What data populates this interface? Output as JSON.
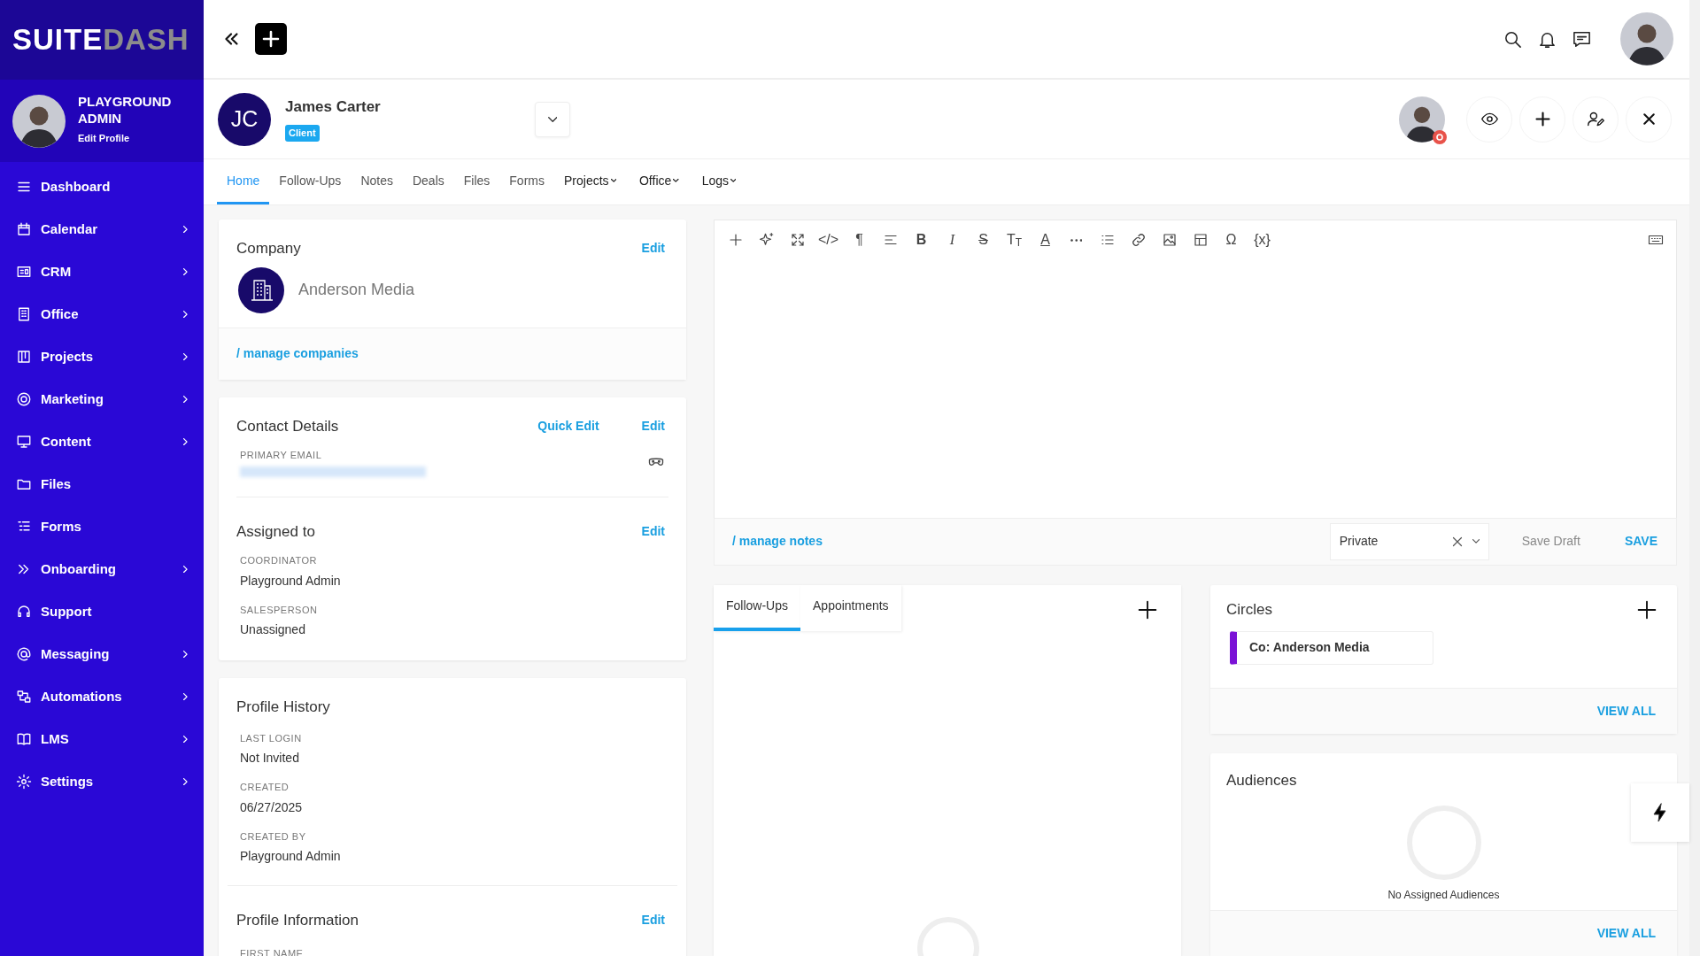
{
  "logo": {
    "first": "SUITE",
    "second": "DASH"
  },
  "profile": {
    "name": "PLAYGROUND ADMIN",
    "link": "Edit Profile"
  },
  "nav": [
    {
      "label": "Dashboard",
      "expandable": false
    },
    {
      "label": "Calendar",
      "expandable": true
    },
    {
      "label": "CRM",
      "expandable": true
    },
    {
      "label": "Office",
      "expandable": true
    },
    {
      "label": "Projects",
      "expandable": true
    },
    {
      "label": "Marketing",
      "expandable": true
    },
    {
      "label": "Content",
      "expandable": true
    },
    {
      "label": "Files",
      "expandable": false
    },
    {
      "label": "Forms",
      "expandable": false
    },
    {
      "label": "Onboarding",
      "expandable": true
    },
    {
      "label": "Support",
      "expandable": false
    },
    {
      "label": "Messaging",
      "expandable": true
    },
    {
      "label": "Automations",
      "expandable": true
    },
    {
      "label": "LMS",
      "expandable": true
    },
    {
      "label": "Settings",
      "expandable": true
    }
  ],
  "contact": {
    "initials": "JC",
    "name": "James Carter",
    "badge": "Client"
  },
  "tabs": [
    {
      "label": "Home",
      "selected": true,
      "dropdown": false
    },
    {
      "label": "Follow-Ups",
      "selected": false,
      "dropdown": false
    },
    {
      "label": "Notes",
      "selected": false,
      "dropdown": false
    },
    {
      "label": "Deals",
      "selected": false,
      "dropdown": false
    },
    {
      "label": "Files",
      "selected": false,
      "dropdown": false
    },
    {
      "label": "Forms",
      "selected": false,
      "dropdown": false
    },
    {
      "label": "Projects",
      "selected": false,
      "dropdown": true
    },
    {
      "label": "Office",
      "selected": false,
      "dropdown": true
    },
    {
      "label": "Logs",
      "selected": false,
      "dropdown": true
    }
  ],
  "company": {
    "title": "Company",
    "edit": "Edit",
    "name": "Anderson Media",
    "link": "/ manage companies"
  },
  "contact_details": {
    "title": "Contact Details",
    "actions": [
      "Quick Edit",
      "Edit"
    ],
    "fields": [
      {
        "label": "PRIMARY EMAIL"
      }
    ]
  },
  "assigned": {
    "title": "Assigned to",
    "edit": "Edit",
    "fields": [
      {
        "label": "COORDINATOR",
        "value": "Playground Admin"
      },
      {
        "label": "SALESPERSON",
        "value": "Unassigned"
      }
    ]
  },
  "history": {
    "title": "Profile History",
    "fields": [
      {
        "label": "LAST LOGIN",
        "value": "Not Invited"
      },
      {
        "label": "CREATED",
        "value": "06/27/2025"
      },
      {
        "label": "CREATED BY",
        "value": "Playground Admin"
      }
    ]
  },
  "profile_info": {
    "title": "Profile Information",
    "edit": "Edit",
    "fields": [
      {
        "label": "FIRST NAME"
      }
    ]
  },
  "toolbar": [
    {
      "kind": "icon"
    },
    {
      "kind": "icon"
    },
    {
      "kind": "icon"
    },
    {
      "kind": "glyph",
      "text": "</>"
    },
    {
      "kind": "glyph",
      "text": "¶"
    },
    {
      "kind": "icon"
    },
    {
      "kind": "bold",
      "text": "B"
    },
    {
      "kind": "italic",
      "text": "I"
    },
    {
      "kind": "strike",
      "text": "S"
    },
    {
      "kind": "glyph",
      "text": "T$_{T}$"
    },
    {
      "kind": "underline",
      "text": "A"
    },
    {
      "kind": "icon"
    },
    {
      "kind": "icon"
    },
    {
      "kind": "icon"
    },
    {
      "kind": "icon"
    },
    {
      "kind": "icon"
    },
    {
      "kind": "glyph",
      "text": "Ω"
    },
    {
      "kind": "glyph",
      "text": "{x}"
    }
  ],
  "notes_footer": {
    "link": "/ manage notes",
    "visibility": "Private",
    "draft": "Save Draft",
    "save": "SAVE"
  },
  "activity_tabs": [
    {
      "label": "Follow-Ups",
      "selected": true
    },
    {
      "label": "Appointments",
      "selected": false
    }
  ],
  "circles": {
    "title": "Circles",
    "items": [
      {
        "label": "Co: Anderson Media",
        "color": "#7b12d6"
      }
    ],
    "view_all": "VIEW ALL"
  },
  "audiences": {
    "title": "Audiences",
    "empty": "No Assigned Audiences",
    "view_all": "VIEW ALL"
  }
}
